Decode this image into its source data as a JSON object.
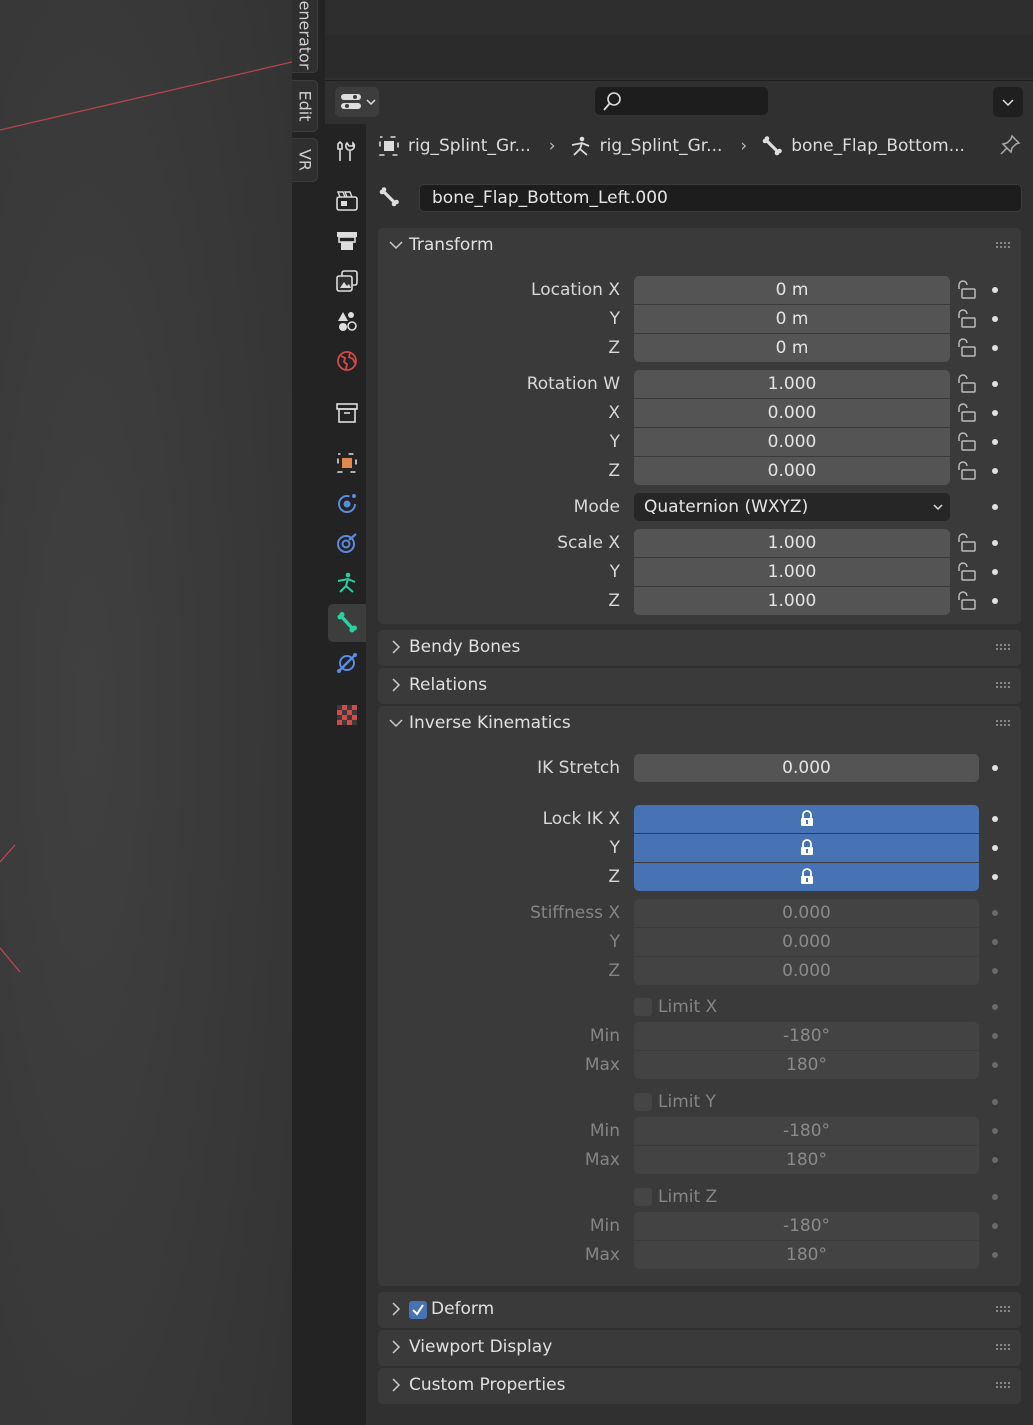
{
  "viewport": {
    "sidebar_tabs": [
      "enerator",
      "Edit",
      "VR"
    ]
  },
  "header": {
    "search_placeholder": ""
  },
  "tabs": [
    {
      "icon": "tool-icon",
      "active": false
    },
    {
      "icon": "render-icon",
      "active": false
    },
    {
      "icon": "output-icon",
      "active": false
    },
    {
      "icon": "view-layer-icon",
      "active": false
    },
    {
      "icon": "scene-icon",
      "active": false
    },
    {
      "icon": "world-icon",
      "active": false
    },
    {
      "icon": "collection-icon",
      "active": false
    },
    {
      "icon": "object-icon",
      "active": false
    },
    {
      "icon": "modifier-icon",
      "active": false
    },
    {
      "icon": "physics-icon",
      "active": false
    },
    {
      "icon": "armature-data-icon",
      "active": false
    },
    {
      "icon": "bone-icon",
      "active": true
    },
    {
      "icon": "bone-constraint-icon",
      "active": false
    },
    {
      "icon": "texture-icon",
      "active": false
    }
  ],
  "breadcrumb": {
    "item1": "rig_Splint_Gr...",
    "item2": "rig_Splint_Gr...",
    "item3": "bone_Flap_Bottom..."
  },
  "bone_name": "bone_Flap_Bottom_Left.000",
  "transform": {
    "title": "Transform",
    "location_label": "Location X",
    "y_label": "Y",
    "z_label": "Z",
    "x_label": "X",
    "location": [
      "0 m",
      "0 m",
      "0 m"
    ],
    "rotation_label": "Rotation W",
    "rotation": [
      "1.000",
      "0.000",
      "0.000",
      "0.000"
    ],
    "mode_label": "Mode",
    "mode_value": "Quaternion (WXYZ)",
    "scale_label": "Scale X",
    "scale": [
      "1.000",
      "1.000",
      "1.000"
    ]
  },
  "panels": {
    "bendy_bones": "Bendy Bones",
    "relations": "Relations",
    "ik": "Inverse Kinematics",
    "deform": "Deform",
    "viewport_display": "Viewport Display",
    "custom_properties": "Custom Properties"
  },
  "ik": {
    "stretch_label": "IK Stretch",
    "stretch_value": "0.000",
    "lock_label": "Lock IK X",
    "stiffness_label": "Stiffness X",
    "stiffness": [
      "0.000",
      "0.000",
      "0.000"
    ],
    "limit_x_label": "Limit X",
    "limit_y_label": "Limit Y",
    "limit_z_label": "Limit Z",
    "min_label": "Min",
    "max_label": "Max",
    "min_value": "-180°",
    "max_value": "180°"
  },
  "colors": {
    "accent_blue": "#4772b3",
    "bone_tab_green": "#2bd0a0",
    "object_orange": "#e0894a"
  }
}
